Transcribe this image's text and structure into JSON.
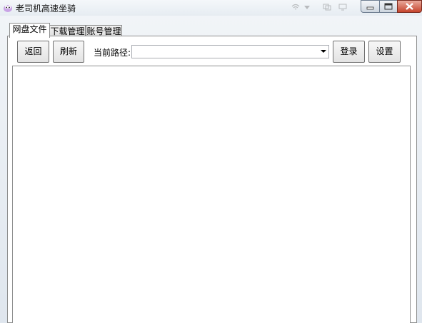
{
  "window": {
    "title": "老司机高速坐骑",
    "title_bar_ghost_icons": [
      "wifi-icon",
      "dropdown-arrow-icon",
      "copy-icon",
      "monitor-icon"
    ]
  },
  "tabs": [
    {
      "label": "网盘文件",
      "active": true
    },
    {
      "label": "下载管理",
      "active": false
    },
    {
      "label": "账号管理",
      "active": false
    }
  ],
  "toolbar": {
    "back_label": "返回",
    "refresh_label": "刷新",
    "path_label": "当前路径:",
    "path_value": "",
    "login_label": "登录",
    "settings_label": "设置"
  }
}
